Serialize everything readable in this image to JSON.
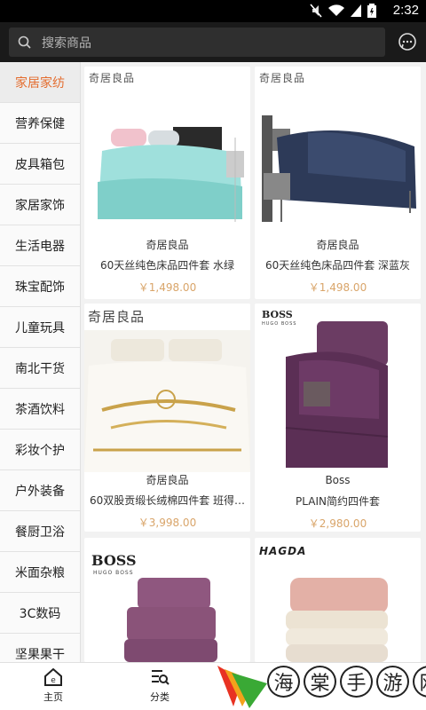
{
  "status_bar": {
    "time": "2:32"
  },
  "search": {
    "placeholder": "搜索商品"
  },
  "sidebar": {
    "items": [
      {
        "label": "家居家纺"
      },
      {
        "label": "营养保健"
      },
      {
        "label": "皮具箱包"
      },
      {
        "label": "家居家饰"
      },
      {
        "label": "生活电器"
      },
      {
        "label": "珠宝配饰"
      },
      {
        "label": "儿童玩具"
      },
      {
        "label": "南北干货"
      },
      {
        "label": "茶酒饮料"
      },
      {
        "label": "彩妆个护"
      },
      {
        "label": "户外装备"
      },
      {
        "label": "餐厨卫浴"
      },
      {
        "label": "米面杂粮"
      },
      {
        "label": "3C数码"
      },
      {
        "label": "坚果果干"
      }
    ]
  },
  "products": [
    {
      "logo": "奇居良品",
      "brand": "奇居良品",
      "name": "60天丝纯色床品四件套  水绿",
      "price": "￥1,498.00"
    },
    {
      "logo": "奇居良品",
      "brand": "奇居良品",
      "name": "60天丝纯色床品四件套  深蓝灰",
      "price": "￥1,498.00"
    },
    {
      "logo": "奇居良品",
      "brand": "奇居良品",
      "name": "60双股贡缎长绒棉四件套 班得…",
      "price": "￥3,998.00"
    },
    {
      "logo": "BOSS",
      "logo_sub": "HUGO BOSS",
      "brand": "Boss",
      "name": "PLAIN简约四件套",
      "price": "￥2,980.00"
    },
    {
      "logo": "BOSS",
      "logo_sub": "HUGO BOSS",
      "brand": "",
      "name": "",
      "price": ""
    },
    {
      "logo": "HAGDA",
      "brand": "",
      "name": "",
      "price": ""
    }
  ],
  "tabbar": {
    "tabs": [
      {
        "label": "主页",
        "icon": "home-icon"
      },
      {
        "label": "分类",
        "icon": "category-icon"
      }
    ]
  },
  "watermark": {
    "chars": [
      "海",
      "棠",
      "手",
      "游",
      "网"
    ]
  },
  "colors": {
    "accent": "#e46d2f",
    "price": "#d9a56a",
    "topbar": "#1a1a1a"
  }
}
